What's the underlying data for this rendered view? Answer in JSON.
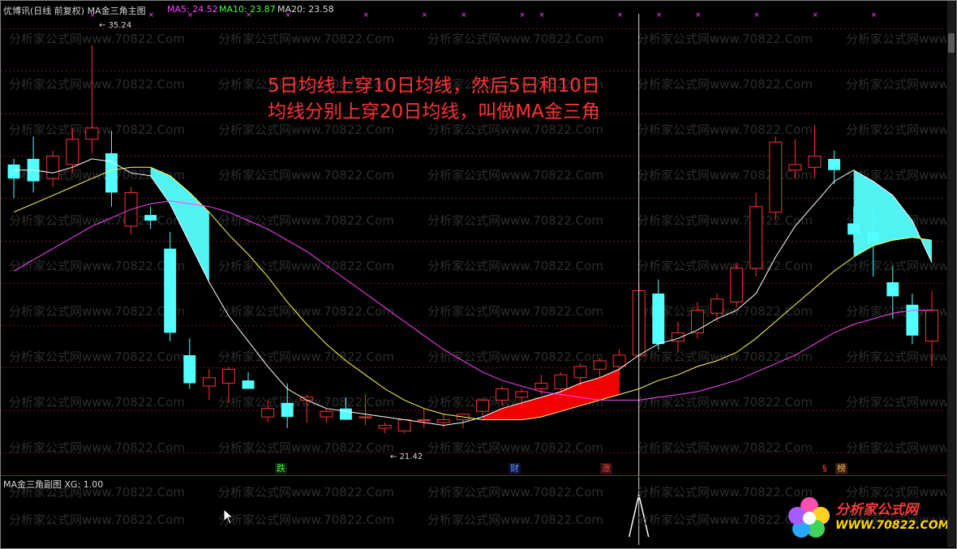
{
  "header": {
    "title": "优博讯(日线 前复权) MA金三角主图",
    "ma5": "MA5: 24.52",
    "ma10": "MA10: 23.87",
    "ma20": "MA20: 23.58"
  },
  "annotation": {
    "line1": "5日均线上穿10日均线，然后5日和10日",
    "line2": "均线分别上穿20日均线，叫做MA金三角"
  },
  "price_labels": {
    "high": "35.24",
    "low": "21.42"
  },
  "events": {
    "die": "跌",
    "cai": "财",
    "zhang": "涨",
    "s": "§",
    "bang": "榜"
  },
  "sub_panel": {
    "title": "MA金三角副图  XG: 1.00"
  },
  "watermark": {
    "text": "分析家公式网www.70822.Com"
  },
  "logo": {
    "name": "分析家公式网",
    "url": "WWW.70822.COM"
  },
  "colors": {
    "up": "#ff3232",
    "down": "#54ffff",
    "ma5": "#ffffff",
    "ma10": "#ffff55",
    "ma20": "#ff44ff",
    "golden_triangle": "#ff0000",
    "death_triangle": "#54ffff"
  },
  "chart_data": {
    "type": "candlestick",
    "ylim": [
      20.5,
      36.2
    ],
    "candles": [
      {
        "o": 31.0,
        "h": 31.2,
        "l": 29.8,
        "c": 30.5
      },
      {
        "o": 31.2,
        "h": 32.0,
        "l": 30.0,
        "c": 30.4
      },
      {
        "o": 30.5,
        "h": 31.5,
        "l": 30.2,
        "c": 31.3
      },
      {
        "o": 31.0,
        "h": 32.3,
        "l": 30.7,
        "c": 31.9
      },
      {
        "o": 31.9,
        "h": 35.24,
        "l": 31.4,
        "c": 32.3
      },
      {
        "o": 31.4,
        "h": 32.2,
        "l": 29.5,
        "c": 30.0
      },
      {
        "o": 28.8,
        "h": 30.2,
        "l": 28.5,
        "c": 30.0
      },
      {
        "o": 29.2,
        "h": 29.5,
        "l": 28.7,
        "c": 29.0
      },
      {
        "o": 28.0,
        "h": 28.6,
        "l": 24.7,
        "c": 25.0
      },
      {
        "o": 24.2,
        "h": 24.8,
        "l": 23.0,
        "c": 23.2
      },
      {
        "o": 23.1,
        "h": 23.7,
        "l": 22.6,
        "c": 23.4
      },
      {
        "o": 23.2,
        "h": 23.8,
        "l": 22.5,
        "c": 23.7
      },
      {
        "o": 23.3,
        "h": 23.6,
        "l": 23.0,
        "c": 23.0
      },
      {
        "o": 22.0,
        "h": 22.6,
        "l": 21.8,
        "c": 22.3
      },
      {
        "o": 22.5,
        "h": 23.2,
        "l": 21.6,
        "c": 22.0
      },
      {
        "o": 22.6,
        "h": 22.8,
        "l": 21.8,
        "c": 22.7
      },
      {
        "o": 22.0,
        "h": 22.3,
        "l": 21.8,
        "c": 22.2
      },
      {
        "o": 22.3,
        "h": 22.7,
        "l": 21.9,
        "c": 21.9
      },
      {
        "o": 22.0,
        "h": 22.8,
        "l": 21.7,
        "c": 22.0
      },
      {
        "o": 21.6,
        "h": 21.8,
        "l": 21.42,
        "c": 21.7
      },
      {
        "o": 21.5,
        "h": 21.9,
        "l": 21.42,
        "c": 21.9
      },
      {
        "o": 21.9,
        "h": 22.3,
        "l": 21.6,
        "c": 21.9
      },
      {
        "o": 21.8,
        "h": 22.1,
        "l": 21.6,
        "c": 21.9
      },
      {
        "o": 21.9,
        "h": 22.1,
        "l": 21.6,
        "c": 22.1
      },
      {
        "o": 22.2,
        "h": 22.6,
        "l": 22.0,
        "c": 22.6
      },
      {
        "o": 22.6,
        "h": 23.1,
        "l": 22.4,
        "c": 23.0
      },
      {
        "o": 22.7,
        "h": 23.0,
        "l": 22.3,
        "c": 22.9
      },
      {
        "o": 23.0,
        "h": 23.5,
        "l": 22.8,
        "c": 23.2
      },
      {
        "o": 23.0,
        "h": 23.6,
        "l": 22.8,
        "c": 23.5
      },
      {
        "o": 23.4,
        "h": 23.9,
        "l": 23.1,
        "c": 23.8
      },
      {
        "o": 23.7,
        "h": 24.1,
        "l": 23.4,
        "c": 24.0
      },
      {
        "o": 23.8,
        "h": 24.4,
        "l": 23.5,
        "c": 24.2
      },
      {
        "o": 24.2,
        "h": 26.8,
        "l": 24.0,
        "c": 26.5
      },
      {
        "o": 26.4,
        "h": 26.9,
        "l": 24.4,
        "c": 24.6
      },
      {
        "o": 24.7,
        "h": 25.4,
        "l": 24.3,
        "c": 25.0
      },
      {
        "o": 25.0,
        "h": 26.1,
        "l": 24.8,
        "c": 25.8
      },
      {
        "o": 25.7,
        "h": 26.4,
        "l": 25.4,
        "c": 26.2
      },
      {
        "o": 26.1,
        "h": 27.5,
        "l": 25.9,
        "c": 27.3
      },
      {
        "o": 27.3,
        "h": 30.0,
        "l": 27.0,
        "c": 29.5
      },
      {
        "o": 29.3,
        "h": 32.0,
        "l": 29.0,
        "c": 31.8
      },
      {
        "o": 30.8,
        "h": 31.9,
        "l": 30.5,
        "c": 31.0
      },
      {
        "o": 30.9,
        "h": 32.4,
        "l": 30.5,
        "c": 31.3
      },
      {
        "o": 31.2,
        "h": 31.5,
        "l": 30.3,
        "c": 30.8
      },
      {
        "o": 28.9,
        "h": 29.5,
        "l": 28.2,
        "c": 28.5
      },
      {
        "o": 28.6,
        "h": 29.5,
        "l": 27.0,
        "c": 28.2
      },
      {
        "o": 26.8,
        "h": 27.4,
        "l": 25.5,
        "c": 26.3
      },
      {
        "o": 26.0,
        "h": 26.4,
        "l": 24.6,
        "c": 24.9
      },
      {
        "o": 24.7,
        "h": 26.5,
        "l": 23.8,
        "c": 25.8
      }
    ],
    "series": [
      {
        "name": "MA5",
        "values": [
          30.8,
          30.8,
          30.7,
          30.9,
          31.2,
          31.1,
          30.7,
          30.6,
          29.6,
          28.2,
          26.8,
          25.6,
          24.7,
          23.8,
          23.0,
          22.6,
          22.3,
          22.2,
          22.1,
          22.0,
          21.9,
          21.8,
          21.7,
          21.8,
          22.0,
          22.3,
          22.5,
          22.7,
          22.9,
          23.2,
          23.4,
          23.7,
          24.2,
          24.6,
          24.8,
          25.1,
          25.5,
          25.8,
          26.4,
          27.7,
          28.8,
          29.6,
          30.4,
          30.8,
          30.4,
          29.9,
          29.0,
          27.5
        ]
      },
      {
        "name": "MA10",
        "values": [
          29.3,
          29.6,
          29.9,
          30.2,
          30.5,
          30.8,
          30.9,
          30.9,
          30.6,
          30.0,
          29.3,
          28.5,
          27.8,
          27.0,
          26.1,
          25.3,
          24.6,
          24.0,
          23.5,
          23.0,
          22.6,
          22.3,
          22.1,
          22.0,
          21.9,
          21.9,
          21.9,
          22.0,
          22.2,
          22.4,
          22.6,
          22.8,
          23.0,
          23.3,
          23.5,
          23.8,
          24.0,
          24.3,
          24.8,
          25.4,
          26.0,
          26.6,
          27.2,
          27.7,
          28.1,
          28.3,
          28.4,
          28.3
        ]
      },
      {
        "name": "MA20",
        "values": [
          27.2,
          27.6,
          28.0,
          28.4,
          28.8,
          29.1,
          29.4,
          29.6,
          29.7,
          29.6,
          29.5,
          29.3,
          29.0,
          28.7,
          28.3,
          27.9,
          27.4,
          26.9,
          26.4,
          25.9,
          25.4,
          24.9,
          24.4,
          24.0,
          23.6,
          23.3,
          23.1,
          22.9,
          22.8,
          22.7,
          22.6,
          22.6,
          22.6,
          22.7,
          22.8,
          22.9,
          23.1,
          23.3,
          23.6,
          23.9,
          24.2,
          24.6,
          25.0,
          25.3,
          25.5,
          25.7,
          25.8,
          25.8
        ]
      }
    ],
    "golden_range": [
      24,
      31
    ],
    "death_range": [
      7,
      10
    ],
    "death_range_2": [
      43,
      47
    ],
    "signals": [
      4,
      7,
      9,
      12,
      14,
      18,
      21,
      23,
      26,
      27,
      31,
      33,
      35,
      38,
      41,
      44
    ],
    "sub_signal_index": 32
  }
}
